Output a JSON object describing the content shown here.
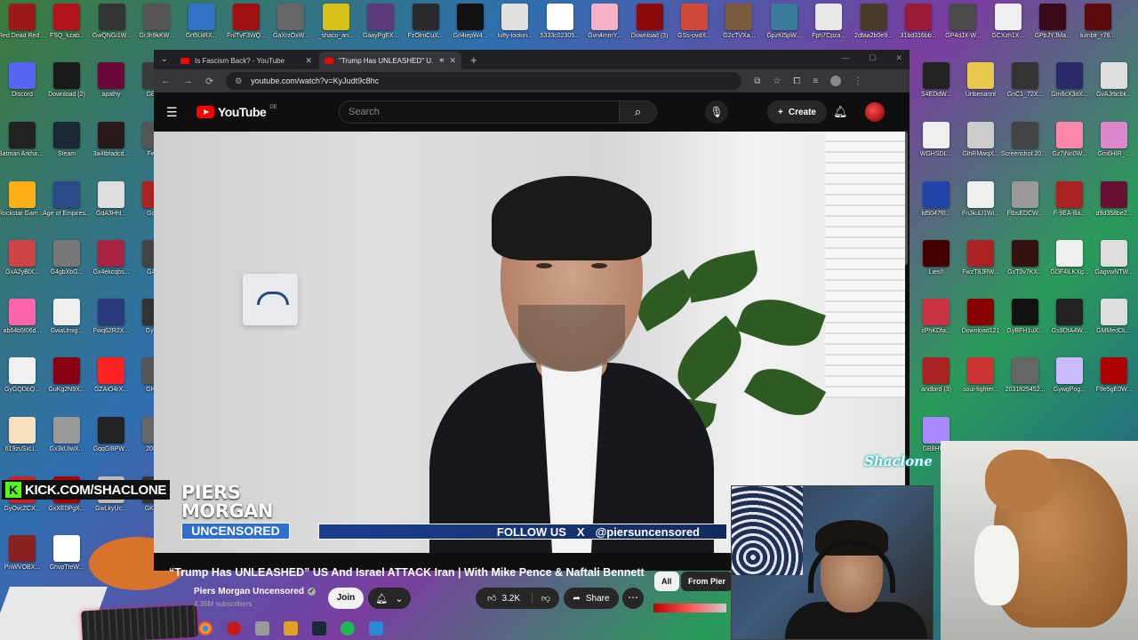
{
  "desktop": {
    "icons": [
      {
        "label": "Red Dead Redempti...",
        "color": "#9b1b1b"
      },
      {
        "label": "FSQ_kzab...",
        "color": "#b3141b"
      },
      {
        "label": "GwQNGi1W...",
        "color": "#333333"
      },
      {
        "label": "GrJh9kKW...",
        "color": "#555555"
      },
      {
        "label": "Grt5UiRX...",
        "color": "#2f74c4"
      },
      {
        "label": "FnITvF3WQ...",
        "color": "#a01010"
      },
      {
        "label": "GaXrzOxW...",
        "color": "#666666"
      },
      {
        "label": "_shaco_an...",
        "color": "#d8c21a"
      },
      {
        "label": "GaayPgEX...",
        "color": "#5a3a7a"
      },
      {
        "label": "FzOlmCuX...",
        "color": "#2a2a2a"
      },
      {
        "label": "Grl4iepW4...",
        "color": "#111111"
      },
      {
        "label": "luffy-lookin...",
        "color": "#e0e0e0"
      },
      {
        "label": "5333c02305...",
        "color": "#ffffff"
      },
      {
        "label": "Gvn4mmY...",
        "color": "#f6b0c8"
      },
      {
        "label": "Download (3)",
        "color": "#8a0a0a"
      },
      {
        "label": "GSs-ovdX...",
        "color": "#d04a3a"
      },
      {
        "label": "G2cTVXa...",
        "color": "#7a5a3a"
      },
      {
        "label": "GpzKl5pW...",
        "color": "#3a7a9a"
      },
      {
        "label": "Fph7Cpza...",
        "color": "#e8e8e8"
      },
      {
        "label": "2dfaa2b0e9...",
        "color": "#4a3a2a"
      },
      {
        "label": "31bd316bb...",
        "color": "#9a1a3a"
      },
      {
        "label": "GP4dJX-W...",
        "color": "#4a4a4a"
      },
      {
        "label": "GCXzh1X...",
        "color": "#eeeeee"
      },
      {
        "label": "GPbJYJMa...",
        "color": "#3a0a1a"
      },
      {
        "label": "tumblr_r76...",
        "color": "#5a0a0a"
      },
      {
        "label": "Discord",
        "color": "#5865f2"
      },
      {
        "label": "Download (2)",
        "color": "#1a1a1a"
      },
      {
        "label": "apathy",
        "color": "#6a0a3a"
      },
      {
        "label": "GBls...",
        "color": "#3a3a3a"
      },
      {
        "label": "Batman Arkham As...",
        "color": "#222222"
      },
      {
        "label": "Steam",
        "color": "#1b2838"
      },
      {
        "label": "3a4fbfadcd...",
        "color": "#2a1a1a"
      },
      {
        "label": "Fwu...",
        "color": "#555555"
      },
      {
        "label": "Rockstar Games ...",
        "color": "#fcaf17"
      },
      {
        "label": "Age of Empires...",
        "color": "#2a4a8a"
      },
      {
        "label": "GdA3Hhl...",
        "color": "#dddddd"
      },
      {
        "label": "GcN...",
        "color": "#aa2222"
      },
      {
        "label": "GxA2yBlX...",
        "color": "#cc4444"
      },
      {
        "label": "G4gbXbG...",
        "color": "#777777"
      },
      {
        "label": "Gx4ekcqbs...",
        "color": "#aa2244"
      },
      {
        "label": "GA4...",
        "color": "#444444"
      },
      {
        "label": "ab64b5f06d...",
        "color": "#ff66aa"
      },
      {
        "label": "GwaUmig...",
        "color": "#eeeeee"
      },
      {
        "label": "Fwq62R2X...",
        "color": "#2a3a7a"
      },
      {
        "label": "GyYo...",
        "color": "#333333"
      },
      {
        "label": "GyGQDbQ...",
        "color": "#f0f0f0"
      },
      {
        "label": "GuKg2N9X...",
        "color": "#880011"
      },
      {
        "label": "GZAiO4rX...",
        "color": "#ff2222"
      },
      {
        "label": "GKQ...",
        "color": "#555555"
      },
      {
        "label": "619zuSxLl...",
        "color": "#f6e0c0"
      },
      {
        "label": "Gx3kUIwX...",
        "color": "#999999"
      },
      {
        "label": "GqqGl8PW...",
        "color": "#222222"
      },
      {
        "label": "2083...",
        "color": "#666666"
      },
      {
        "label": "GyOvcZCX...",
        "color": "#cc2222"
      },
      {
        "label": "GxXE0PgX...",
        "color": "#aa0000"
      },
      {
        "label": "GwLkyUc...",
        "color": "#bbbbbb"
      },
      {
        "label": "GK5X...",
        "color": "#333333"
      },
      {
        "label": "PnWVOBX...",
        "color": "#882222"
      },
      {
        "label": "GhvpTteW...",
        "color": "#ffffff"
      },
      {
        "label": "S4EDdW...",
        "color": "#222222"
      },
      {
        "label": "Unbenannt",
        "color": "#e8c84a"
      },
      {
        "label": "GnC1_72X...",
        "color": "#333333"
      },
      {
        "label": "Gm6cX3oX...",
        "color": "#2a2a6a"
      },
      {
        "label": "GvAJrbcbk...",
        "color": "#dddddd"
      },
      {
        "label": "WGHSDL...",
        "color": "#eeeeee"
      },
      {
        "label": "GlhRMwqX...",
        "color": "#cccccc"
      },
      {
        "label": "Screenshot 2023-06-...",
        "color": "#444444"
      },
      {
        "label": "Gz7jNn0W...",
        "color": "#ff88aa"
      },
      {
        "label": "Gm6HIR_...",
        "color": "#dd88cc"
      },
      {
        "label": "fd5047f0...",
        "color": "#2244aa"
      },
      {
        "label": "FnJkuU1Wi...",
        "color": "#eeeeee"
      },
      {
        "label": "FtbsEDCW...",
        "color": "#999999"
      },
      {
        "label": "F-9EA-Ba...",
        "color": "#aa2222"
      },
      {
        "label": "d9d358be2...",
        "color": "#661133"
      },
      {
        "label": "Lies!!",
        "color": "#440000"
      },
      {
        "label": "FwzT8JRW...",
        "color": "#aa2222"
      },
      {
        "label": "GxT0v7KX...",
        "color": "#331111"
      },
      {
        "label": "GDF4lLKXg...",
        "color": "#eeeeee"
      },
      {
        "label": "GagvwNTW...",
        "color": "#dddddd"
      },
      {
        "label": "zPhKDfa...",
        "color": "#cc3344"
      },
      {
        "label": "Download121",
        "color": "#880000"
      },
      {
        "label": "GyBFH1uX...",
        "color": "#111111"
      },
      {
        "label": "Gs9DfA4W...",
        "color": "#222222"
      },
      {
        "label": "GMMedDL...",
        "color": "#dddddd"
      },
      {
        "label": "andbird (3)",
        "color": "#aa2222"
      },
      {
        "label": "soul-fighter...",
        "color": "#cc3333"
      },
      {
        "label": "2031825452...",
        "color": "#666666"
      },
      {
        "label": "GywgPog...",
        "color": "#ccbbff"
      },
      {
        "label": "F9e5gE0W...",
        "color": "#aa0000"
      },
      {
        "label": "GB8HW...",
        "color": "#aa88ff"
      }
    ]
  },
  "browser": {
    "tabs": [
      {
        "title": "Is Fascism Back? - YouTube",
        "active": false
      },
      {
        "title": "\"Trump Has UNLEASHED\" U...",
        "active": true
      }
    ],
    "tab_list_icon": "chevron-down-icon",
    "new_tab_label": "+",
    "url": "youtube.com/watch?v=KyJudt9c8hc",
    "nav": {
      "back": "←",
      "forward": "→",
      "reload": "⟳"
    }
  },
  "youtube": {
    "logo_text": "YouTube",
    "country_code": "DE",
    "search_placeholder": "Search",
    "create_label": "Create",
    "video": {
      "overlay_kick": "KICK.COM/SHACLONE",
      "kick_logo": "K",
      "show_logo_line1": "PIERS",
      "show_logo_line2": "MORGAN",
      "show_logo_line3": "UNCENSORED",
      "follow_text": "FOLLOW US",
      "follow_x": "X",
      "follow_handle": "@piersuncensored",
      "title": "“Trump Has UNLEASHED” US And Israel ATTACK Iran | With Mike Pence & Naftali Bennett"
    },
    "channel": {
      "name": "Piers Morgan Uncensored",
      "subscribers": "4.35M subscribers",
      "join_label": "Join"
    },
    "actions": {
      "likes": "3.2K",
      "share_label": "Share",
      "more": "⋯"
    },
    "chips": [
      {
        "label": "All"
      },
      {
        "label": "From Pier"
      }
    ]
  },
  "stream_overlay": {
    "watermark": "Shaclone"
  }
}
